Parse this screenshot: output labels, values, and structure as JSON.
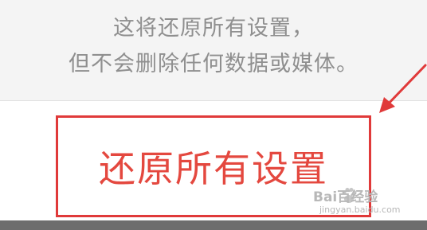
{
  "dialog": {
    "description_line1": "这将还原所有设置，",
    "description_line2": "但不会删除任何数据或媒体。"
  },
  "reset_button": {
    "label": "还原所有设置"
  },
  "annotation": {
    "highlight_color": "#e03a3a"
  },
  "watermark": {
    "line1": "Bai百经验",
    "line2": "jingyan.baidu.com"
  }
}
